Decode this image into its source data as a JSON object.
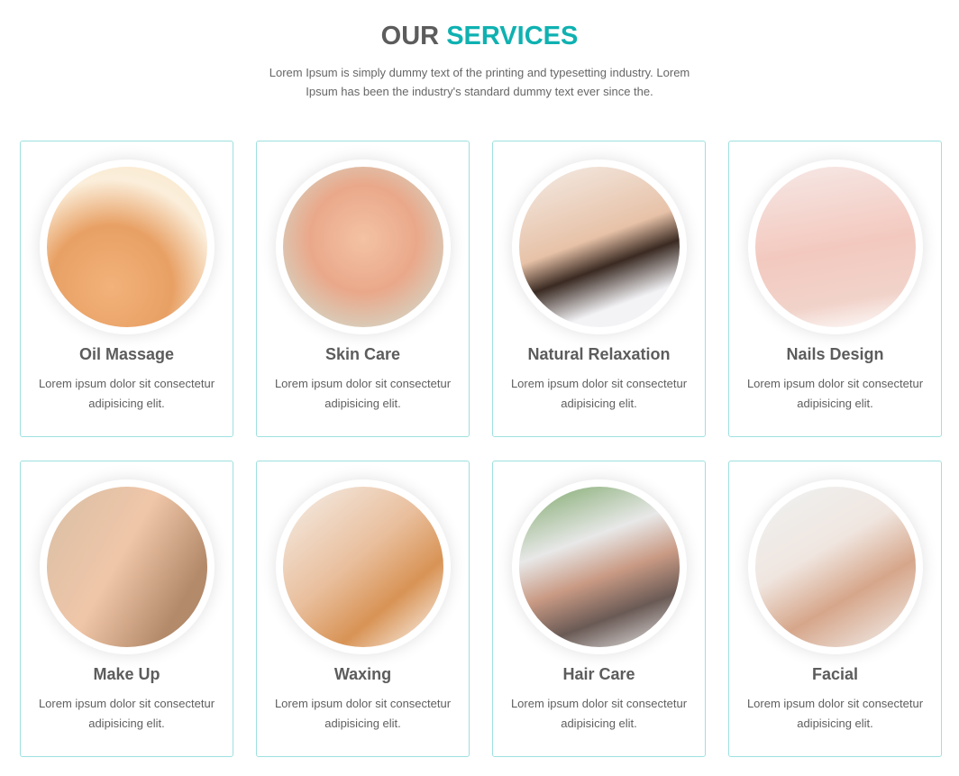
{
  "header": {
    "title_part1": "OUR",
    "title_part2": "SERVICES",
    "subtitle": "Lorem Ipsum is simply dummy text of the printing and typesetting industry. Lorem Ipsum has been the industry's standard dummy text ever since the."
  },
  "accent_color": "#0fb1b1",
  "services": [
    {
      "title": "Oil Massage",
      "desc": "Lorem ipsum dolor sit consectetur adipisicing elit."
    },
    {
      "title": "Skin Care",
      "desc": "Lorem ipsum dolor sit consectetur adipisicing elit."
    },
    {
      "title": "Natural Relaxation",
      "desc": "Lorem ipsum dolor sit consectetur adipisicing elit."
    },
    {
      "title": "Nails Design",
      "desc": "Lorem ipsum dolor sit consectetur adipisicing elit."
    },
    {
      "title": "Make Up",
      "desc": "Lorem ipsum dolor sit consectetur adipisicing elit."
    },
    {
      "title": "Waxing",
      "desc": "Lorem ipsum dolor sit consectetur adipisicing elit."
    },
    {
      "title": "Hair Care",
      "desc": "Lorem ipsum dolor sit consectetur adipisicing elit."
    },
    {
      "title": "Facial",
      "desc": "Lorem ipsum dolor sit consectetur adipisicing elit."
    }
  ]
}
